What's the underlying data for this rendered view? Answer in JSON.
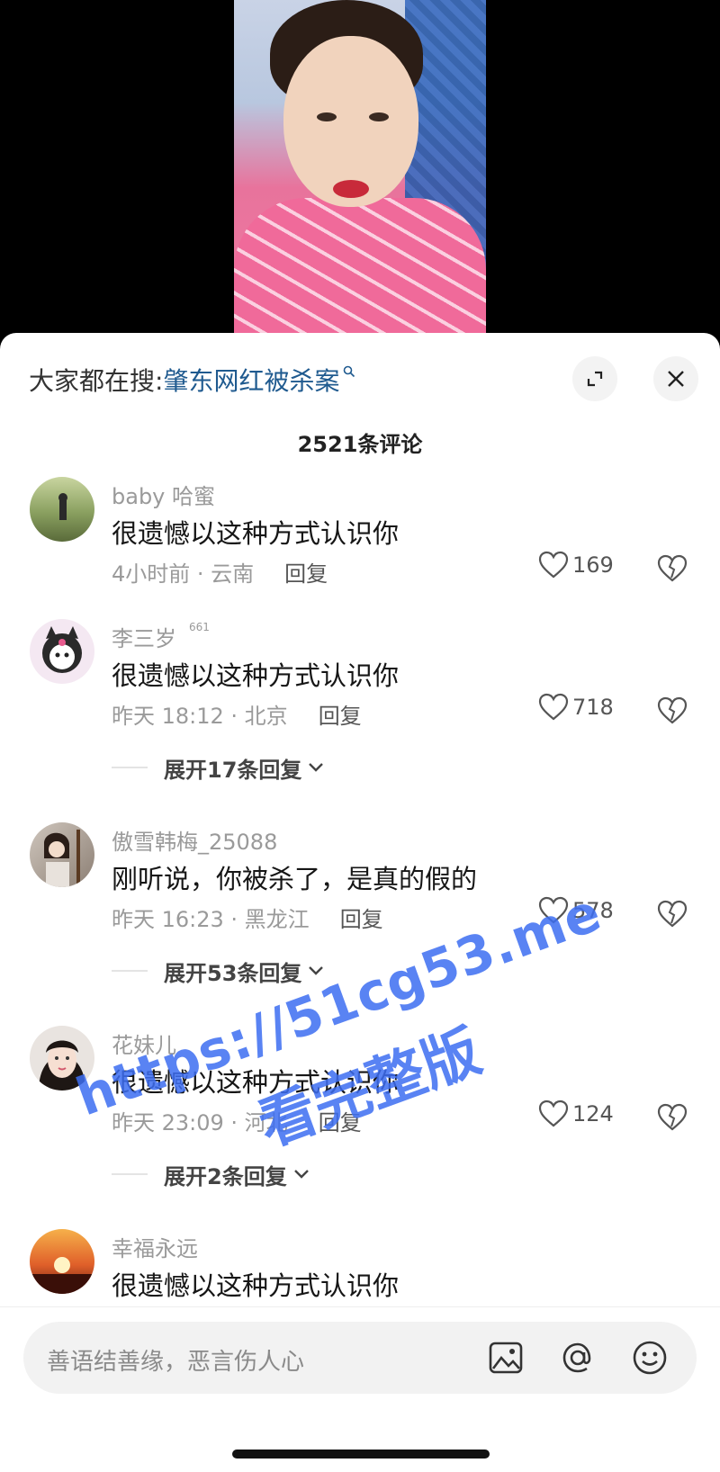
{
  "search_bar": {
    "label": "大家都在搜:",
    "term": "肇东网红被杀案"
  },
  "comment_count": "2521条评论",
  "comments": [
    {
      "user": "baby 哈蜜",
      "badge": "",
      "text": "很遗憾以这种方式认识你",
      "meta": "4小时前 · 云南",
      "reply": "回复",
      "likes": "169"
    },
    {
      "user": "李三岁",
      "badge": "661",
      "text": "很遗憾以这种方式认识你",
      "meta": "昨天 18:12 · 北京",
      "reply": "回复",
      "likes": "718"
    },
    {
      "user": "傲雪韩梅_25088",
      "badge": "",
      "text": "刚听说，你被杀了，是真的假的",
      "meta": "昨天 16:23 · 黑龙江",
      "reply": "回复",
      "likes": "578"
    },
    {
      "user": "花妹儿",
      "badge": "",
      "text": "很遗憾以这种方式认识你",
      "meta": "昨天 23:09 · 河北",
      "reply": "回复",
      "likes": "124"
    },
    {
      "user": "幸福永远",
      "badge": "",
      "text": "很遗憾以这种方式认识你",
      "meta": "",
      "reply": "",
      "likes": ""
    }
  ],
  "expand_replies": [
    {
      "label": "展开17条回复"
    },
    {
      "label": "展开53条回复"
    },
    {
      "label": "展开2条回复"
    }
  ],
  "input": {
    "placeholder": "善语结善缘，恶言伤人心"
  },
  "watermark": {
    "line1": "https://51cg53.me",
    "line2": "看完整版"
  },
  "colors": {
    "accent_link": "#1f5a8f",
    "watermark": "#3d6ef2"
  }
}
